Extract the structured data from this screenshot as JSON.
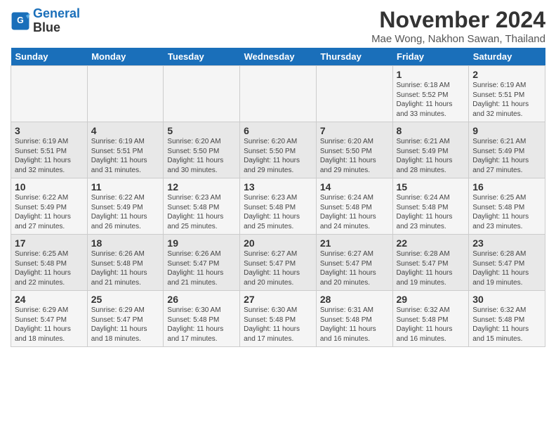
{
  "logo": {
    "line1": "General",
    "line2": "Blue"
  },
  "title": "November 2024",
  "subtitle": "Mae Wong, Nakhon Sawan, Thailand",
  "headers": [
    "Sunday",
    "Monday",
    "Tuesday",
    "Wednesday",
    "Thursday",
    "Friday",
    "Saturday"
  ],
  "weeks": [
    [
      {
        "day": "",
        "info": ""
      },
      {
        "day": "",
        "info": ""
      },
      {
        "day": "",
        "info": ""
      },
      {
        "day": "",
        "info": ""
      },
      {
        "day": "",
        "info": ""
      },
      {
        "day": "1",
        "info": "Sunrise: 6:18 AM\nSunset: 5:52 PM\nDaylight: 11 hours and 33 minutes."
      },
      {
        "day": "2",
        "info": "Sunrise: 6:19 AM\nSunset: 5:51 PM\nDaylight: 11 hours and 32 minutes."
      }
    ],
    [
      {
        "day": "3",
        "info": "Sunrise: 6:19 AM\nSunset: 5:51 PM\nDaylight: 11 hours and 32 minutes."
      },
      {
        "day": "4",
        "info": "Sunrise: 6:19 AM\nSunset: 5:51 PM\nDaylight: 11 hours and 31 minutes."
      },
      {
        "day": "5",
        "info": "Sunrise: 6:20 AM\nSunset: 5:50 PM\nDaylight: 11 hours and 30 minutes."
      },
      {
        "day": "6",
        "info": "Sunrise: 6:20 AM\nSunset: 5:50 PM\nDaylight: 11 hours and 29 minutes."
      },
      {
        "day": "7",
        "info": "Sunrise: 6:20 AM\nSunset: 5:50 PM\nDaylight: 11 hours and 29 minutes."
      },
      {
        "day": "8",
        "info": "Sunrise: 6:21 AM\nSunset: 5:49 PM\nDaylight: 11 hours and 28 minutes."
      },
      {
        "day": "9",
        "info": "Sunrise: 6:21 AM\nSunset: 5:49 PM\nDaylight: 11 hours and 27 minutes."
      }
    ],
    [
      {
        "day": "10",
        "info": "Sunrise: 6:22 AM\nSunset: 5:49 PM\nDaylight: 11 hours and 27 minutes."
      },
      {
        "day": "11",
        "info": "Sunrise: 6:22 AM\nSunset: 5:49 PM\nDaylight: 11 hours and 26 minutes."
      },
      {
        "day": "12",
        "info": "Sunrise: 6:23 AM\nSunset: 5:48 PM\nDaylight: 11 hours and 25 minutes."
      },
      {
        "day": "13",
        "info": "Sunrise: 6:23 AM\nSunset: 5:48 PM\nDaylight: 11 hours and 25 minutes."
      },
      {
        "day": "14",
        "info": "Sunrise: 6:24 AM\nSunset: 5:48 PM\nDaylight: 11 hours and 24 minutes."
      },
      {
        "day": "15",
        "info": "Sunrise: 6:24 AM\nSunset: 5:48 PM\nDaylight: 11 hours and 23 minutes."
      },
      {
        "day": "16",
        "info": "Sunrise: 6:25 AM\nSunset: 5:48 PM\nDaylight: 11 hours and 23 minutes."
      }
    ],
    [
      {
        "day": "17",
        "info": "Sunrise: 6:25 AM\nSunset: 5:48 PM\nDaylight: 11 hours and 22 minutes."
      },
      {
        "day": "18",
        "info": "Sunrise: 6:26 AM\nSunset: 5:48 PM\nDaylight: 11 hours and 21 minutes."
      },
      {
        "day": "19",
        "info": "Sunrise: 6:26 AM\nSunset: 5:47 PM\nDaylight: 11 hours and 21 minutes."
      },
      {
        "day": "20",
        "info": "Sunrise: 6:27 AM\nSunset: 5:47 PM\nDaylight: 11 hours and 20 minutes."
      },
      {
        "day": "21",
        "info": "Sunrise: 6:27 AM\nSunset: 5:47 PM\nDaylight: 11 hours and 20 minutes."
      },
      {
        "day": "22",
        "info": "Sunrise: 6:28 AM\nSunset: 5:47 PM\nDaylight: 11 hours and 19 minutes."
      },
      {
        "day": "23",
        "info": "Sunrise: 6:28 AM\nSunset: 5:47 PM\nDaylight: 11 hours and 19 minutes."
      }
    ],
    [
      {
        "day": "24",
        "info": "Sunrise: 6:29 AM\nSunset: 5:47 PM\nDaylight: 11 hours and 18 minutes."
      },
      {
        "day": "25",
        "info": "Sunrise: 6:29 AM\nSunset: 5:47 PM\nDaylight: 11 hours and 18 minutes."
      },
      {
        "day": "26",
        "info": "Sunrise: 6:30 AM\nSunset: 5:48 PM\nDaylight: 11 hours and 17 minutes."
      },
      {
        "day": "27",
        "info": "Sunrise: 6:30 AM\nSunset: 5:48 PM\nDaylight: 11 hours and 17 minutes."
      },
      {
        "day": "28",
        "info": "Sunrise: 6:31 AM\nSunset: 5:48 PM\nDaylight: 11 hours and 16 minutes."
      },
      {
        "day": "29",
        "info": "Sunrise: 6:32 AM\nSunset: 5:48 PM\nDaylight: 11 hours and 16 minutes."
      },
      {
        "day": "30",
        "info": "Sunrise: 6:32 AM\nSunset: 5:48 PM\nDaylight: 11 hours and 15 minutes."
      }
    ]
  ]
}
